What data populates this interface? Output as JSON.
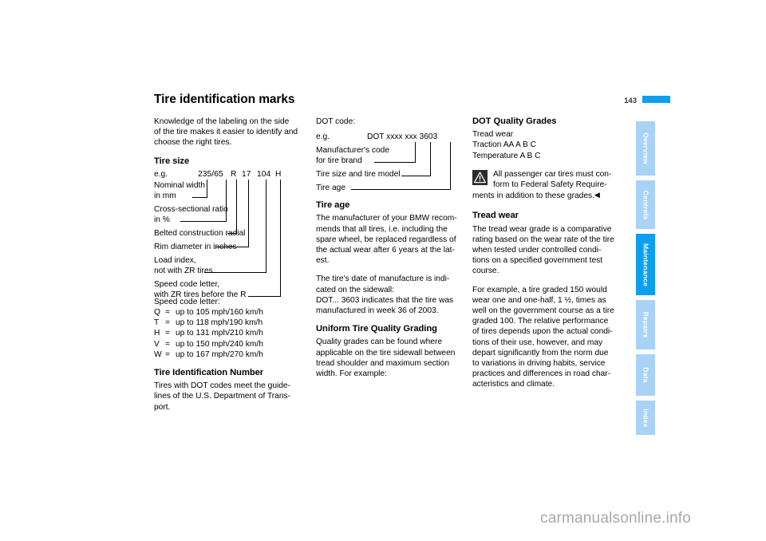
{
  "header": {
    "title": "Tire identification marks",
    "page_number": "143",
    "accent_color": "#0b9ff0"
  },
  "left_column": {
    "intro": [
      "Knowledge of the labeling on the side",
      "of the tire makes it easier to identify and",
      "choose the right tires."
    ],
    "tire_size_heading": "Tire size",
    "tire_size_diagram": {
      "eg_label": "e.g.",
      "code_parts": [
        {
          "text": "235/65",
          "label": "Nominal width in mm"
        },
        {
          "text": "R",
          "label": "Cross-sectional ratio in %"
        },
        {
          "text": "17",
          "label": "Belted construction radial"
        },
        {
          "text": "104",
          "label": "Rim diameter in inches"
        },
        {
          "text": "H",
          "label": "Load index, not with ZR tires"
        }
      ],
      "labels": [
        [
          "Nominal width",
          "in mm"
        ],
        [
          "Cross-sectional ratio",
          "in %"
        ],
        [
          "Belted construction radial"
        ],
        [
          "Rim diameter in inches"
        ],
        [
          "Load index,",
          "not with ZR tires"
        ],
        [
          "Speed code letter,",
          "with ZR tires before the R"
        ]
      ]
    },
    "speed_code_caption": "Speed code letter:",
    "speed_codes": [
      {
        "letter": "Q",
        "eq": "=",
        "value": "up to 105 mph/160 km/h"
      },
      {
        "letter": "T",
        "eq": "=",
        "value": "up to 118 mph/190 km/h"
      },
      {
        "letter": "H",
        "eq": "=",
        "value": "up to 131 mph/210 km/h"
      },
      {
        "letter": "V",
        "eq": "=",
        "value": "up to 150 mph/240 km/h"
      },
      {
        "letter": "W",
        "eq": "=",
        "value": "up to 167 mph/270 km/h"
      }
    ],
    "tin_heading": "Tire Identification Number",
    "tin_text": [
      "Tires with DOT codes meet the guide-",
      "lines of the U.S. Department of Trans-",
      "port."
    ]
  },
  "middle_column": {
    "dot_code_caption": "DOT code:",
    "dot_code_diagram": {
      "eg_label": "e.g.",
      "code": "DOT xxxx xxx 3603",
      "labels": [
        [
          "Manufacturer's code",
          "for tire brand"
        ],
        [
          "Tire size and tire model"
        ],
        [
          "Tire age"
        ]
      ]
    },
    "tire_age_heading": "Tire age",
    "tire_age_p1": [
      "The manufacturer of your BMW recom-",
      "mends that all tires, i.e. including the",
      "spare wheel, be replaced regardless of",
      "the actual wear after 6 years at the lat-",
      "est."
    ],
    "tire_age_p2": [
      "The tire's date of manufacture is indi-",
      "cated on the sidewall:",
      "DOT... 3603 indicates that the tire was",
      "manufactured in week 36 of 2003."
    ],
    "utqg_heading": "Uniform Tire Quality Grading",
    "utqg_text": [
      "Quality grades can be found where",
      "applicable on the tire sidewall between",
      "tread shoulder and maximum section",
      "width. For example:"
    ]
  },
  "right_column": {
    "dot_quality_heading": "DOT Quality Grades",
    "dot_quality_items": [
      "Tread wear",
      "Traction AA A B C",
      "Temperature A B C"
    ],
    "warning": {
      "icon": "warning-triangle-icon",
      "lines": [
        "All passenger car tires must con-",
        "form to Federal Safety Require-"
      ],
      "last_line": "ments in addition to these grades.",
      "end_mark": "◀"
    },
    "tread_wear_heading": "Tread wear",
    "tread_wear_p1": [
      "The tread wear grade is a comparative",
      "rating based on the wear rate of the tire",
      "when tested under controlled condi-",
      "tions on a specified government test",
      "course."
    ],
    "tread_wear_p2": [
      "For example, a tire graded 150 would",
      "wear one and one-half, 1 ½, times as",
      "well on the government course as a tire",
      "graded 100. The relative performance",
      "of tires depends upon the actual condi-",
      "tions of their use, however, and may",
      "depart significantly from the norm due",
      "to variations in driving habits, service",
      "practices and differences in road char-",
      "acteristics and climate."
    ]
  },
  "tab_rail": {
    "active_color": "#0b9ff0",
    "inactive_color": "#a9d2f7",
    "tabs": [
      {
        "label": "Overview",
        "active": false
      },
      {
        "label": "Controls",
        "active": false
      },
      {
        "label": "Maintenance",
        "active": true
      },
      {
        "label": "Repairs",
        "active": false
      },
      {
        "label": "Data",
        "active": false
      },
      {
        "label": "Index",
        "active": false
      }
    ]
  },
  "watermark": "carmanualsonline.info"
}
